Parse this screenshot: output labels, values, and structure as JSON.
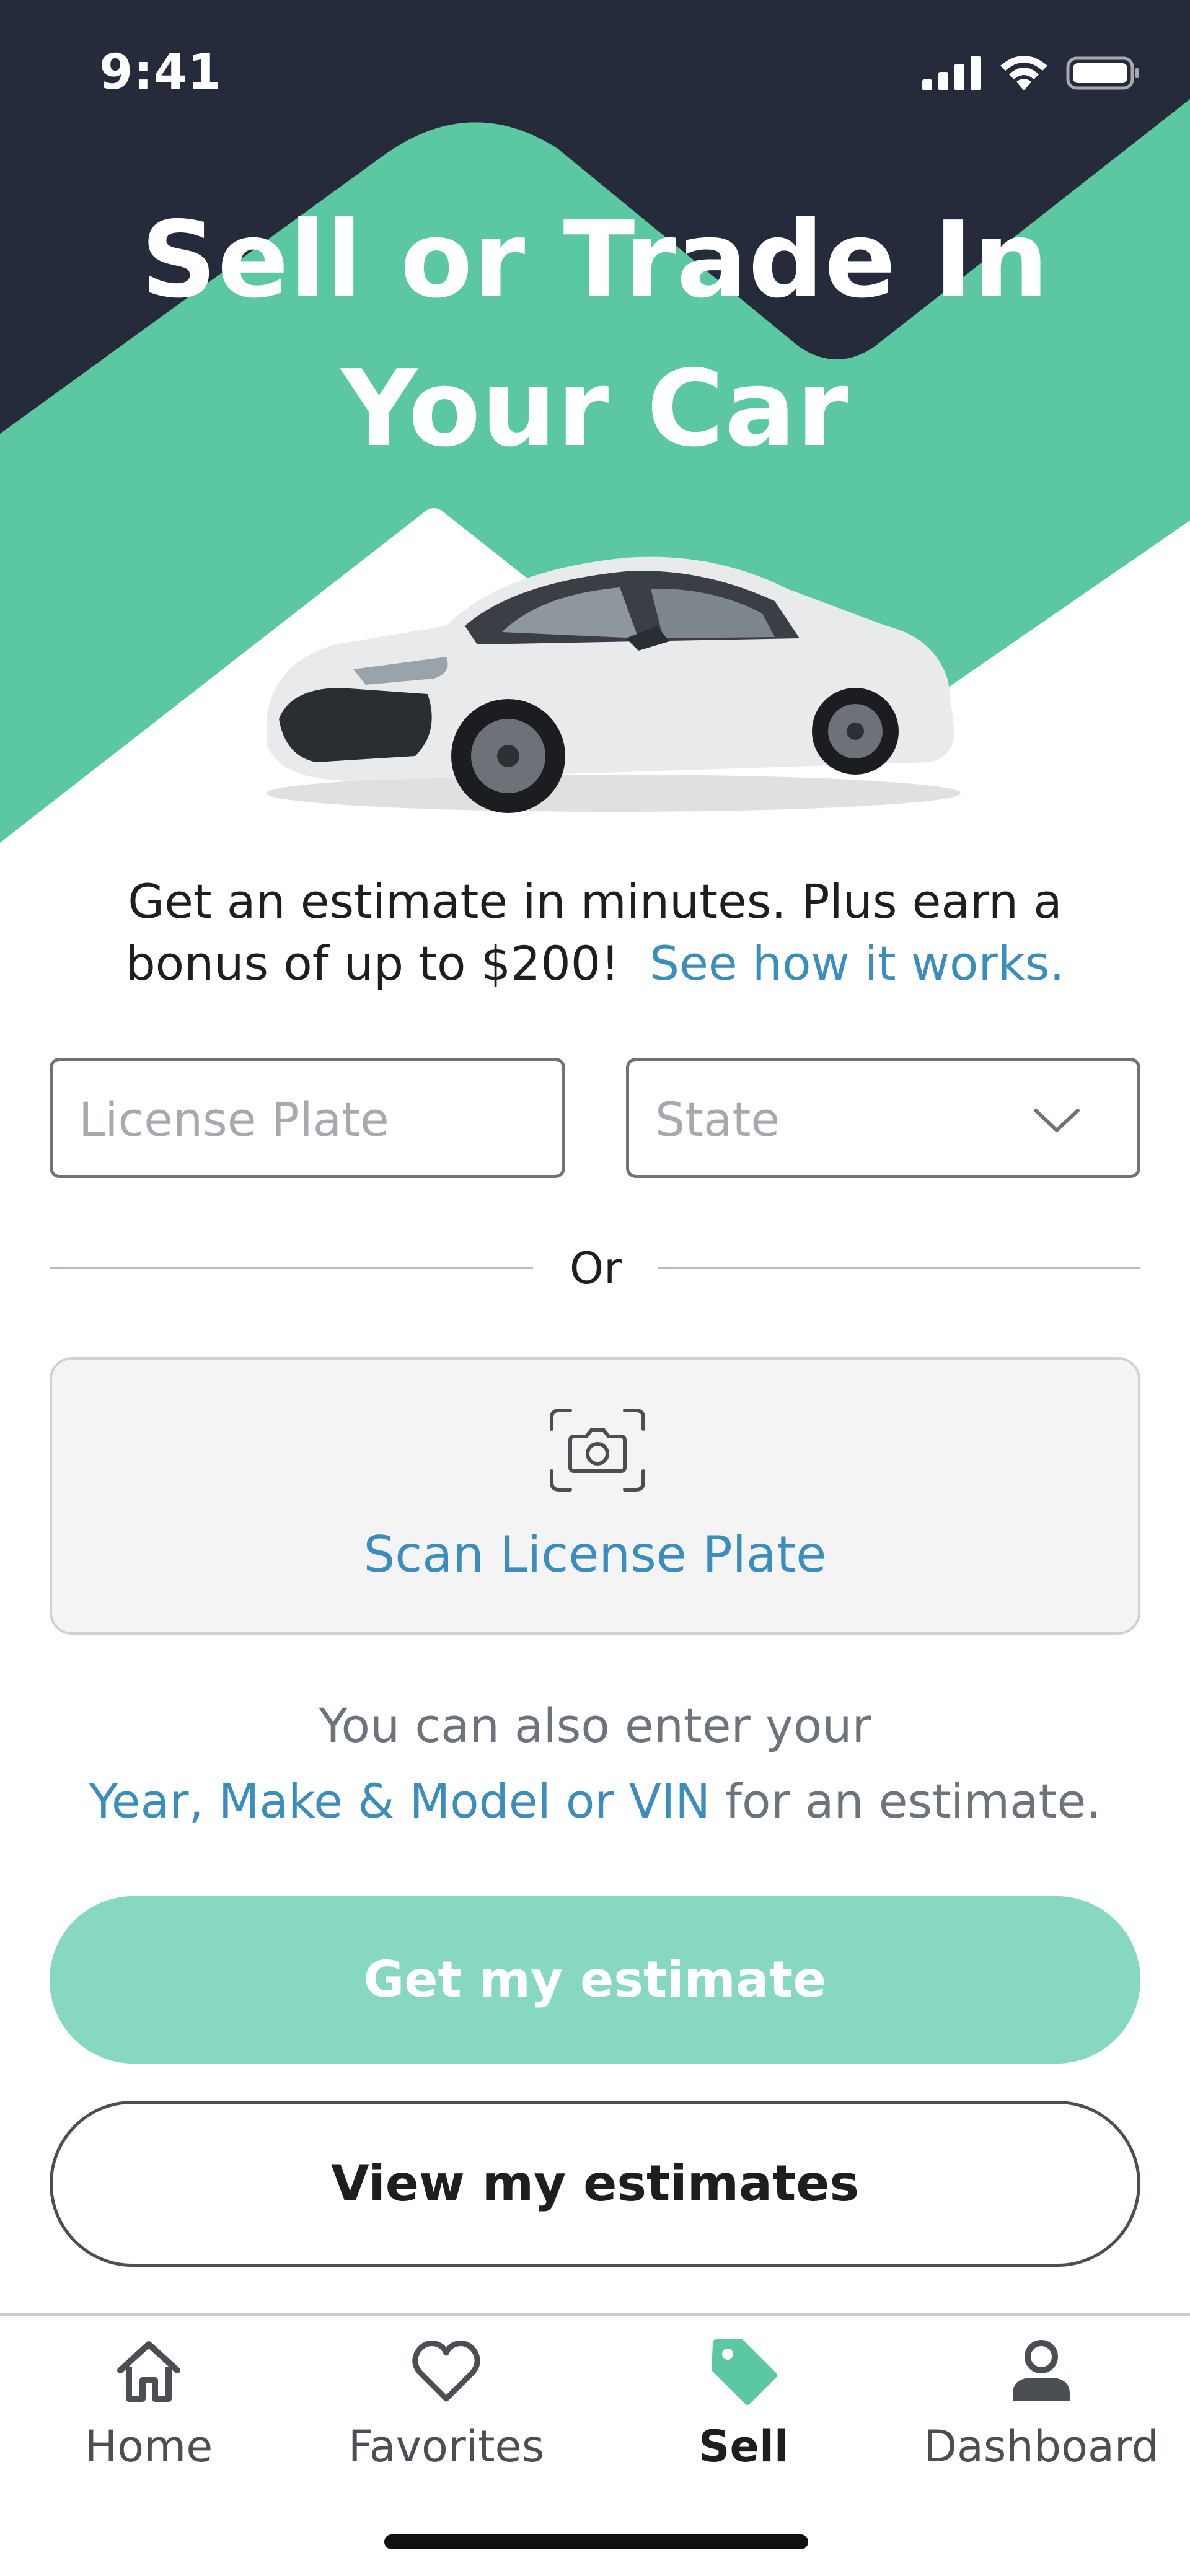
{
  "status_bar": {
    "time": "9:41"
  },
  "hero": {
    "title_line1": "Sell or Trade In",
    "title_line2": "Your Car"
  },
  "intro": {
    "text_line1": "Get an estimate in minutes. Plus earn a",
    "text_line2_prefix": "bonus of up to $200!",
    "link": "See how it works."
  },
  "form": {
    "license_plate_placeholder": "License Plate",
    "state_placeholder": "State",
    "divider_text": "Or",
    "scan_label": "Scan License Plate"
  },
  "helper": {
    "line1": "You can also enter your",
    "link": "Year, Make & Model or VIN",
    "line2_suffix": " for an estimate."
  },
  "buttons": {
    "primary": "Get my estimate",
    "secondary": "View my estimates"
  },
  "tabbar": {
    "items": [
      {
        "label": "Home",
        "icon": "home-icon"
      },
      {
        "label": "Favorites",
        "icon": "heart-icon"
      },
      {
        "label": "Sell",
        "icon": "tag-icon"
      },
      {
        "label": "Dashboard",
        "icon": "person-icon"
      }
    ],
    "active": "Sell"
  },
  "colors": {
    "navy": "#262b3b",
    "green": "#5cc8a2",
    "button_green": "#87d8c1",
    "link_blue": "#3b8dbd"
  }
}
